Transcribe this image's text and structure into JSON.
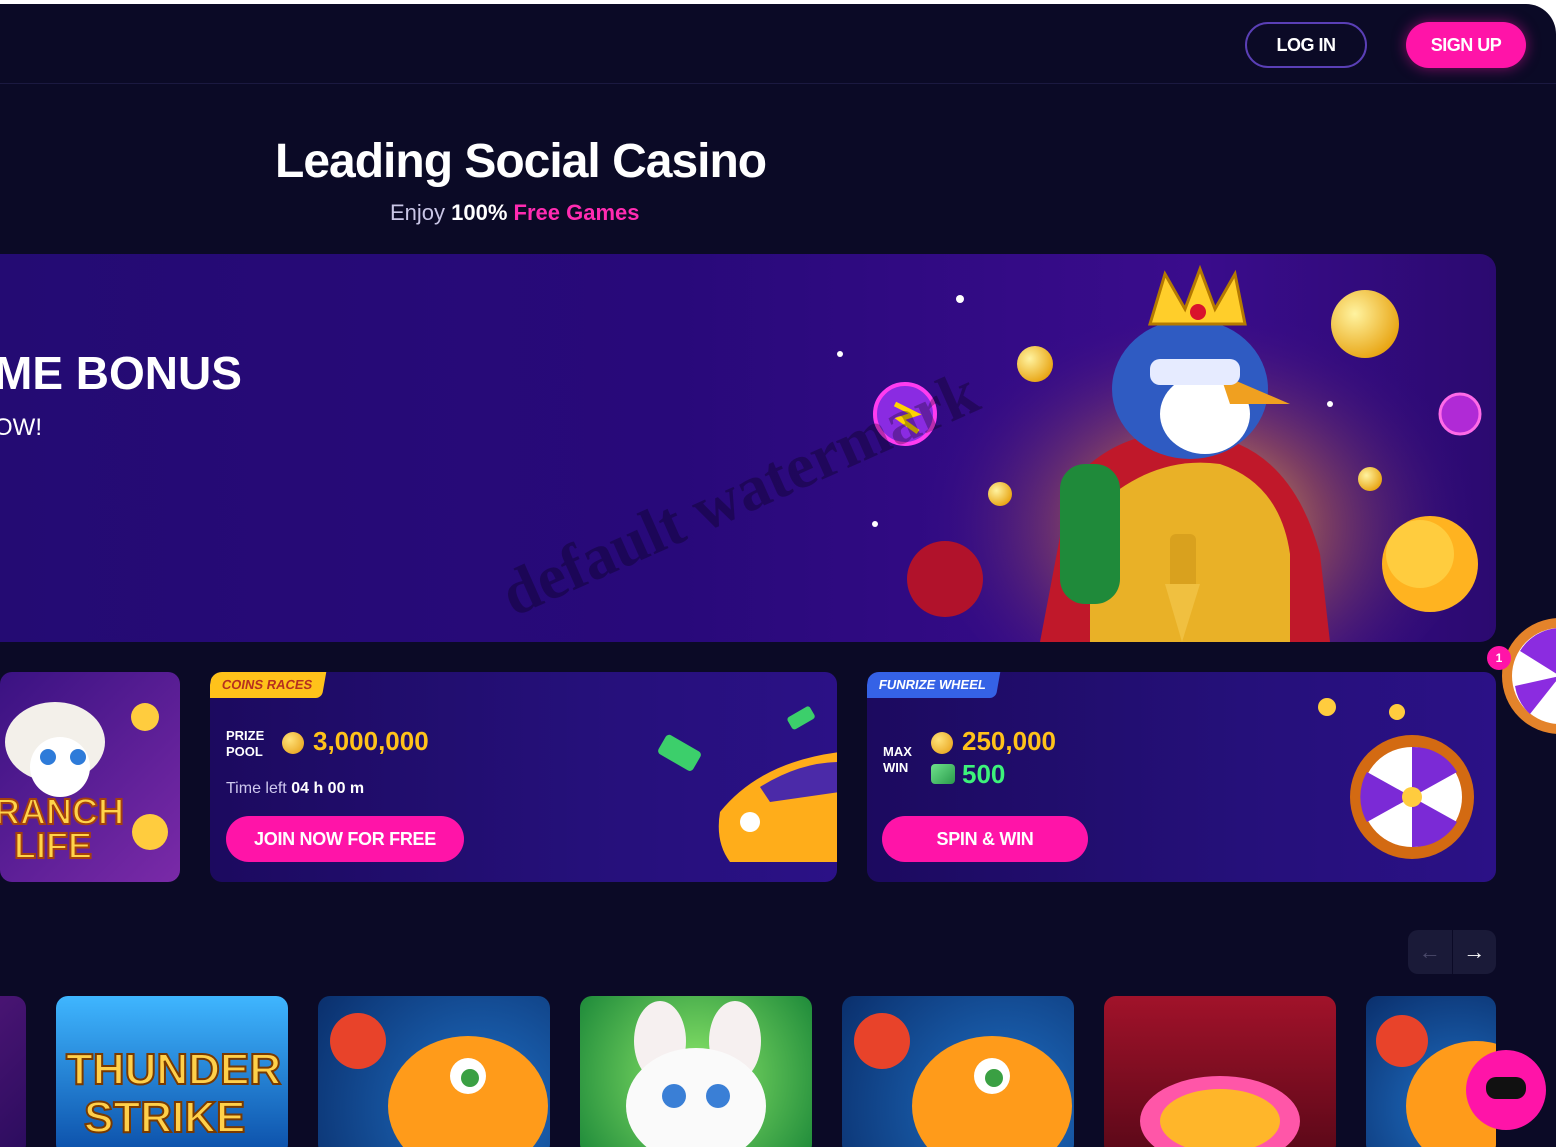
{
  "header": {
    "login_label": "LOG IN",
    "signup_label": "SIGN UP"
  },
  "hero": {
    "title": "Leading Social Casino",
    "subtitle_prefix": "Enjoy ",
    "subtitle_bold": "100%",
    "subtitle_highlight": " Free Games"
  },
  "banner": {
    "title": "ME BONUS",
    "subtitle": "OW!"
  },
  "cards": {
    "ranch": {
      "game_name": "RANCH LIFE"
    },
    "coins_races": {
      "tag": "COINS RACES",
      "prize_label_1": "PRIZE",
      "prize_label_2": "POOL",
      "prize_value": "3,000,000",
      "time_left_label": "Time left",
      "time_left_value": "04 h 00 m",
      "button": "JOIN NOW FOR FREE"
    },
    "funrize_wheel": {
      "tag": "FUNRIZE WHEEL",
      "max_label_1": "MAX",
      "max_label_2": "WIN",
      "coins_value": "250,000",
      "cash_value": "500",
      "button": "SPIN & WIN"
    }
  },
  "side_wheel": {
    "badge": "1"
  },
  "carousel": {
    "prev_icon": "←",
    "next_icon": "→"
  },
  "games": [
    {
      "name": "game-partial"
    },
    {
      "name": "THUNDER STRIKE"
    },
    {
      "name": "fish-game"
    },
    {
      "name": "bunny-game"
    },
    {
      "name": "fish-game"
    },
    {
      "name": "lucky-coins-game"
    },
    {
      "name": "fish-game"
    }
  ],
  "watermark": "default watermark",
  "colors": {
    "background": "#0b0a26",
    "accent_pink": "#ff14a8",
    "gold": "#ffc21a",
    "green": "#3df27a",
    "banner_purple": "#28097a"
  }
}
